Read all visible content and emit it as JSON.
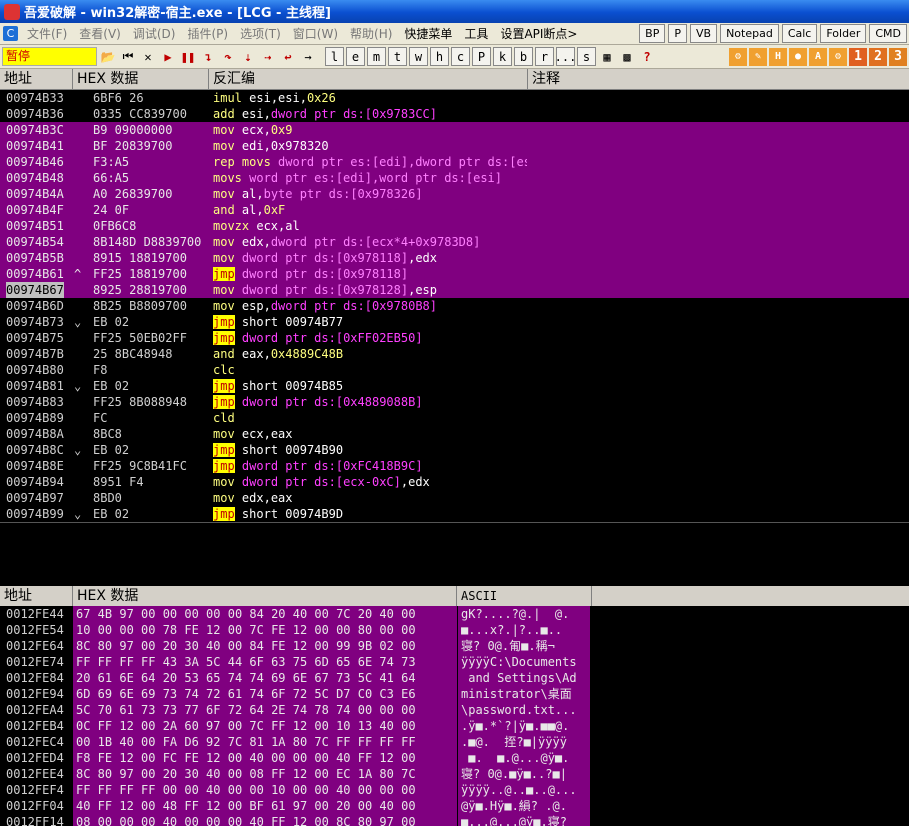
{
  "window": {
    "title": "吾爱破解 - win32解密-宿主.exe - [LCG -  主线程]"
  },
  "menu": {
    "items": [
      "文件(F)",
      "查看(V)",
      "调试(D)",
      "插件(P)",
      "选项(T)",
      "窗口(W)",
      "帮助(H)",
      "快捷菜单",
      "工具",
      "设置API断点>"
    ],
    "buttons": [
      "BP",
      "P",
      "VB",
      "Notepad",
      "Calc",
      "Folder",
      "CMD"
    ]
  },
  "toolbar": {
    "status": "暂停",
    "letters": [
      "l",
      "e",
      "m",
      "t",
      "w",
      "h",
      "c",
      "P",
      "k",
      "b",
      "r",
      "...",
      "s"
    ],
    "nums": [
      "1",
      "2",
      "3"
    ]
  },
  "cpu_headers": {
    "addr": "地址",
    "hex": "HEX 数据",
    "disasm": "反汇编",
    "comment": "注释"
  },
  "disasm_rows": [
    {
      "addr": "00974B33",
      "arrow": "",
      "hex": "6BF6 26",
      "mn": "imul",
      "ops": [
        [
          "op",
          "esi,esi,"
        ],
        [
          "num",
          "0x26"
        ]
      ]
    },
    {
      "addr": "00974B36",
      "arrow": "",
      "hex": "0335 CC839700",
      "mn": "add",
      "ops": [
        [
          "op",
          "esi,"
        ],
        [
          "kw",
          "dword ptr ds:"
        ],
        [
          "mem",
          "[0x9783CC]"
        ]
      ]
    },
    {
      "addr": "00974B3C",
      "arrow": "",
      "hex": "B9 09000000",
      "mn": "mov",
      "ops": [
        [
          "op",
          "ecx,"
        ],
        [
          "num",
          "0x9"
        ]
      ],
      "sel": true
    },
    {
      "addr": "00974B41",
      "arrow": "",
      "hex": "BF 20839700",
      "mn": "mov",
      "ops": [
        [
          "op",
          "edi,"
        ],
        [
          "op",
          "0x978320"
        ]
      ],
      "sel": true
    },
    {
      "addr": "00974B46",
      "arrow": "",
      "hex": "F3:A5",
      "mn": "rep movs",
      "ops": [
        [
          "kw",
          "dword ptr es:[edi],dword ptr ds:[esi]"
        ]
      ],
      "sel": true
    },
    {
      "addr": "00974B48",
      "arrow": "",
      "hex": "66:A5",
      "mn": "movs",
      "ops": [
        [
          "kw",
          "word ptr es:[edi],word ptr ds:[esi]"
        ]
      ],
      "sel": true
    },
    {
      "addr": "00974B4A",
      "arrow": "",
      "hex": "A0 26839700",
      "mn": "mov",
      "ops": [
        [
          "op",
          "al,"
        ],
        [
          "kw",
          "byte ptr ds:"
        ],
        [
          "mem",
          "[0x978326]"
        ]
      ],
      "sel": true
    },
    {
      "addr": "00974B4F",
      "arrow": "",
      "hex": "24 0F",
      "mn": "and",
      "ops": [
        [
          "op",
          "al,"
        ],
        [
          "num",
          "0xF"
        ]
      ],
      "sel": true
    },
    {
      "addr": "00974B51",
      "arrow": "",
      "hex": "0FB6C8",
      "mn": "movzx",
      "ops": [
        [
          "op",
          "ecx,al"
        ]
      ],
      "sel": true
    },
    {
      "addr": "00974B54",
      "arrow": "",
      "hex": "8B148D D8839700",
      "mn": "mov",
      "ops": [
        [
          "op",
          "edx,"
        ],
        [
          "kw",
          "dword ptr ds:"
        ],
        [
          "mem",
          "[ecx*4+0x9783D8]"
        ]
      ],
      "sel": true
    },
    {
      "addr": "00974B5B",
      "arrow": "",
      "hex": "8915 18819700",
      "mn": "mov",
      "ops": [
        [
          "kw",
          "dword ptr ds:"
        ],
        [
          "mem",
          "[0x978118]"
        ],
        [
          "op",
          ",edx"
        ]
      ],
      "sel": true
    },
    {
      "addr": "00974B61",
      "arrow": "^",
      "hex": "FF25 18819700",
      "mn": "jmp",
      "jmp": true,
      "ops": [
        [
          "kw",
          "dword ptr ds:"
        ],
        [
          "mem",
          "[0x978118]"
        ]
      ],
      "sel": true
    },
    {
      "addr": "00974B67",
      "arrow": "",
      "hex": "8925 28819700",
      "mn": "mov",
      "ops": [
        [
          "kw",
          "dword ptr ds:"
        ],
        [
          "mem",
          "[0x978128]"
        ],
        [
          "op",
          ",esp"
        ]
      ],
      "sel": true,
      "cur": true
    },
    {
      "addr": "00974B6D",
      "arrow": "",
      "hex": "8B25 B8809700",
      "mn": "mov",
      "ops": [
        [
          "op",
          "esp,"
        ],
        [
          "kw",
          "dword ptr ds:"
        ],
        [
          "mem",
          "[0x9780B8]"
        ]
      ]
    },
    {
      "addr": "00974B73",
      "arrow": "v",
      "hex": "EB 02",
      "mn": "jmp",
      "jmp": true,
      "ops": [
        [
          "op",
          "short 00974B77"
        ]
      ]
    },
    {
      "addr": "00974B75",
      "arrow": "",
      "hex": "FF25 50EB02FF",
      "mn": "jmp",
      "jmp": true,
      "ops": [
        [
          "kw",
          "dword ptr ds:"
        ],
        [
          "mem",
          "[0xFF02EB50]"
        ]
      ]
    },
    {
      "addr": "00974B7B",
      "arrow": "",
      "hex": "25 8BC48948",
      "mn": "and",
      "ops": [
        [
          "op",
          "eax,"
        ],
        [
          "num",
          "0x4889C48B"
        ]
      ]
    },
    {
      "addr": "00974B80",
      "arrow": "",
      "hex": "F8",
      "mn": "clc",
      "ops": []
    },
    {
      "addr": "00974B81",
      "arrow": "v",
      "hex": "EB 02",
      "mn": "jmp",
      "jmp": true,
      "ops": [
        [
          "op",
          "short 00974B85"
        ]
      ]
    },
    {
      "addr": "00974B83",
      "arrow": "",
      "hex": "FF25 8B088948",
      "mn": "jmp",
      "jmp": true,
      "ops": [
        [
          "kw",
          "dword ptr ds:"
        ],
        [
          "mem",
          "[0x4889088B]"
        ]
      ]
    },
    {
      "addr": "00974B89",
      "arrow": "",
      "hex": "FC",
      "mn": "cld",
      "ops": []
    },
    {
      "addr": "00974B8A",
      "arrow": "",
      "hex": "8BC8",
      "mn": "mov",
      "ops": [
        [
          "op",
          "ecx,eax"
        ]
      ]
    },
    {
      "addr": "00974B8C",
      "arrow": "v",
      "hex": "EB 02",
      "mn": "jmp",
      "jmp": true,
      "ops": [
        [
          "op",
          "short 00974B90"
        ]
      ]
    },
    {
      "addr": "00974B8E",
      "arrow": "",
      "hex": "FF25 9C8B41FC",
      "mn": "jmp",
      "jmp": true,
      "ops": [
        [
          "kw",
          "dword ptr ds:"
        ],
        [
          "mem",
          "[0xFC418B9C]"
        ]
      ]
    },
    {
      "addr": "00974B94",
      "arrow": "",
      "hex": "8951 F4",
      "mn": "mov",
      "ops": [
        [
          "kw",
          "dword ptr ds:"
        ],
        [
          "mem",
          "[ecx-0xC]"
        ],
        [
          "op",
          ",edx"
        ]
      ]
    },
    {
      "addr": "00974B97",
      "arrow": "",
      "hex": "8BD0",
      "mn": "mov",
      "ops": [
        [
          "op",
          "edx,eax"
        ]
      ]
    },
    {
      "addr": "00974B99",
      "arrow": "v",
      "hex": "EB 02",
      "mn": "jmp",
      "jmp": true,
      "ops": [
        [
          "op",
          "short 00974B9D"
        ]
      ]
    }
  ],
  "dump_headers": {
    "addr": "地址",
    "hex": "HEX 数据",
    "ascii": "ASCII"
  },
  "dump_rows": [
    {
      "addr": "0012FE44",
      "hex": "67 4B 97 00 00 00 00 00 84 20 40 00 7C 20 40 00",
      "ascii": "gK?....?@.|  @."
    },
    {
      "addr": "0012FE54",
      "hex": "10 00 00 00 78 FE 12 00 7C FE 12 00 00 80 00 00",
      "ascii": "■...x?.|?..■.."
    },
    {
      "addr": "0012FE64",
      "hex": "8C 80 97 00 20 30 40 00 84 FE 12 00 99 9B 02 00",
      "ascii": "寝? 0@.匍■.稱¬"
    },
    {
      "addr": "0012FE74",
      "hex": "FF FF FF FF 43 3A 5C 44 6F 63 75 6D 65 6E 74 73",
      "ascii": "ÿÿÿÿC:\\Documents"
    },
    {
      "addr": "0012FE84",
      "hex": "20 61 6E 64 20 53 65 74 74 69 6E 67 73 5C 41 64",
      "ascii": " and Settings\\Ad"
    },
    {
      "addr": "0012FE94",
      "hex": "6D 69 6E 69 73 74 72 61 74 6F 72 5C D7 C0 C3 E6",
      "ascii": "ministrator\\桌面"
    },
    {
      "addr": "0012FEA4",
      "hex": "5C 70 61 73 73 77 6F 72 64 2E 74 78 74 00 00 00",
      "ascii": "\\password.txt..."
    },
    {
      "addr": "0012FEB4",
      "hex": "0C FF 12 00 2A 60 97 00 7C FF 12 00 10 13 40 00",
      "ascii": ".ÿ■.*`?|ÿ■.■■@."
    },
    {
      "addr": "0012FEC4",
      "hex": "00 1B 40 00 FA D6 92 7C 81 1A 80 7C FF FF FF FF",
      "ascii": ".■@.  挃?■|ÿÿÿÿ"
    },
    {
      "addr": "0012FED4",
      "hex": "F8 FE 12 00 FC FE 12 00 40 00 00 00 40 FF 12 00",
      "ascii": " ■.  ■.@...@ÿ■."
    },
    {
      "addr": "0012FEE4",
      "hex": "8C 80 97 00 20 30 40 00 08 FF 12 00 EC 1A 80 7C",
      "ascii": "寝? 0@.■ÿ■..?■|"
    },
    {
      "addr": "0012FEF4",
      "hex": "FF FF FF FF 00 00 40 00 00 10 00 00 40 00 00 00",
      "ascii": "ÿÿÿÿ..@..■..@..."
    },
    {
      "addr": "0012FF04",
      "hex": "40 FF 12 00 48 FF 12 00 BF 61 97 00 20 00 40 00",
      "ascii": "@ÿ■.Hÿ■.縜? .@."
    },
    {
      "addr": "0012FF14",
      "hex": "08 00 00 00 40 00 00 00 40 FF 12 00 8C 80 97 00",
      "ascii": "■...@...@ÿ■.寝?"
    }
  ]
}
